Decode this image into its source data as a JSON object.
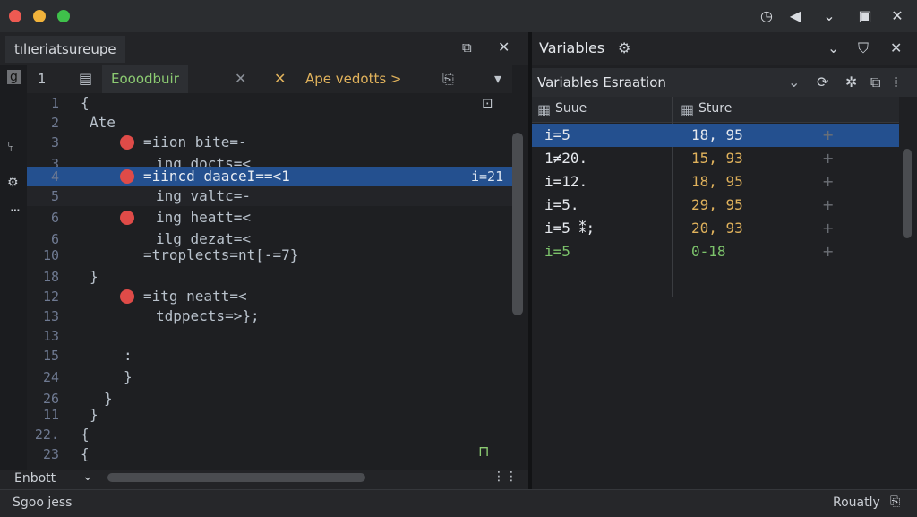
{
  "window": {
    "controls": [
      "clock-icon",
      "back-icon",
      "chevron-down-icon",
      "restore-icon",
      "close-icon"
    ]
  },
  "editor": {
    "tab_title": "tılıeriatsureupe",
    "subtabs": {
      "first": "Eooodbuir",
      "second": "Ape vedotts >"
    },
    "hl_inline_value": "i=21",
    "lines": [
      {
        "num": "1",
        "text": "{"
      },
      {
        "num": "2",
        "text": "Ate"
      },
      {
        "num": "3",
        "text": "=iion bite=-",
        "bp": true
      },
      {
        "num": "3",
        "text": "ing docts=<"
      },
      {
        "num": "4",
        "text": "=iincd daaceI==<1",
        "bp": true,
        "hl": true
      },
      {
        "num": "5",
        "text": "ing valtc=-"
      },
      {
        "num": "6",
        "text": "ing heatt=<",
        "bp": true
      },
      {
        "num": "6",
        "text": "ilg dezat=<"
      },
      {
        "num": "10",
        "text": "=troplects=nt[-=7}"
      },
      {
        "num": "18",
        "text": "}"
      },
      {
        "num": "12",
        "text": "=itg neatt=<",
        "bp": true
      },
      {
        "num": "13",
        "text": "tdppects=>};"
      },
      {
        "num": "13",
        "text": ""
      },
      {
        "num": "15",
        "text": ":"
      },
      {
        "num": "24",
        "text": "}"
      },
      {
        "num": "26",
        "text": "}"
      },
      {
        "num": "11",
        "text": "}"
      },
      {
        "num": "22.",
        "text": "{"
      },
      {
        "num": "23",
        "text": "{"
      }
    ],
    "gutter_top": "1",
    "bottom_label": "Enbott"
  },
  "variables": {
    "panel_title": "Variables",
    "dropdown_value": "Variables Esraation",
    "columns": {
      "name": "Suue",
      "value": "Sture"
    },
    "rows": [
      {
        "name": "i=5",
        "value": "18, 95",
        "selected": true
      },
      {
        "name": "1≠20.",
        "value": "15, 93"
      },
      {
        "name": "i=12.",
        "value": "18, 95"
      },
      {
        "name": "i=5.",
        "value": "29, 95"
      },
      {
        "name": "i=5 ⁑;",
        "value": "20, 93"
      },
      {
        "name": "i=5",
        "value": "0-18",
        "green": true
      }
    ],
    "row_marker": "+"
  },
  "status": {
    "left": "Sgoo jess",
    "right": "Rouatly"
  },
  "colors": {
    "accent": "#24508f",
    "breakpoint": "#df4b48",
    "number": "#e0b25c",
    "green": "#7cc36b"
  }
}
